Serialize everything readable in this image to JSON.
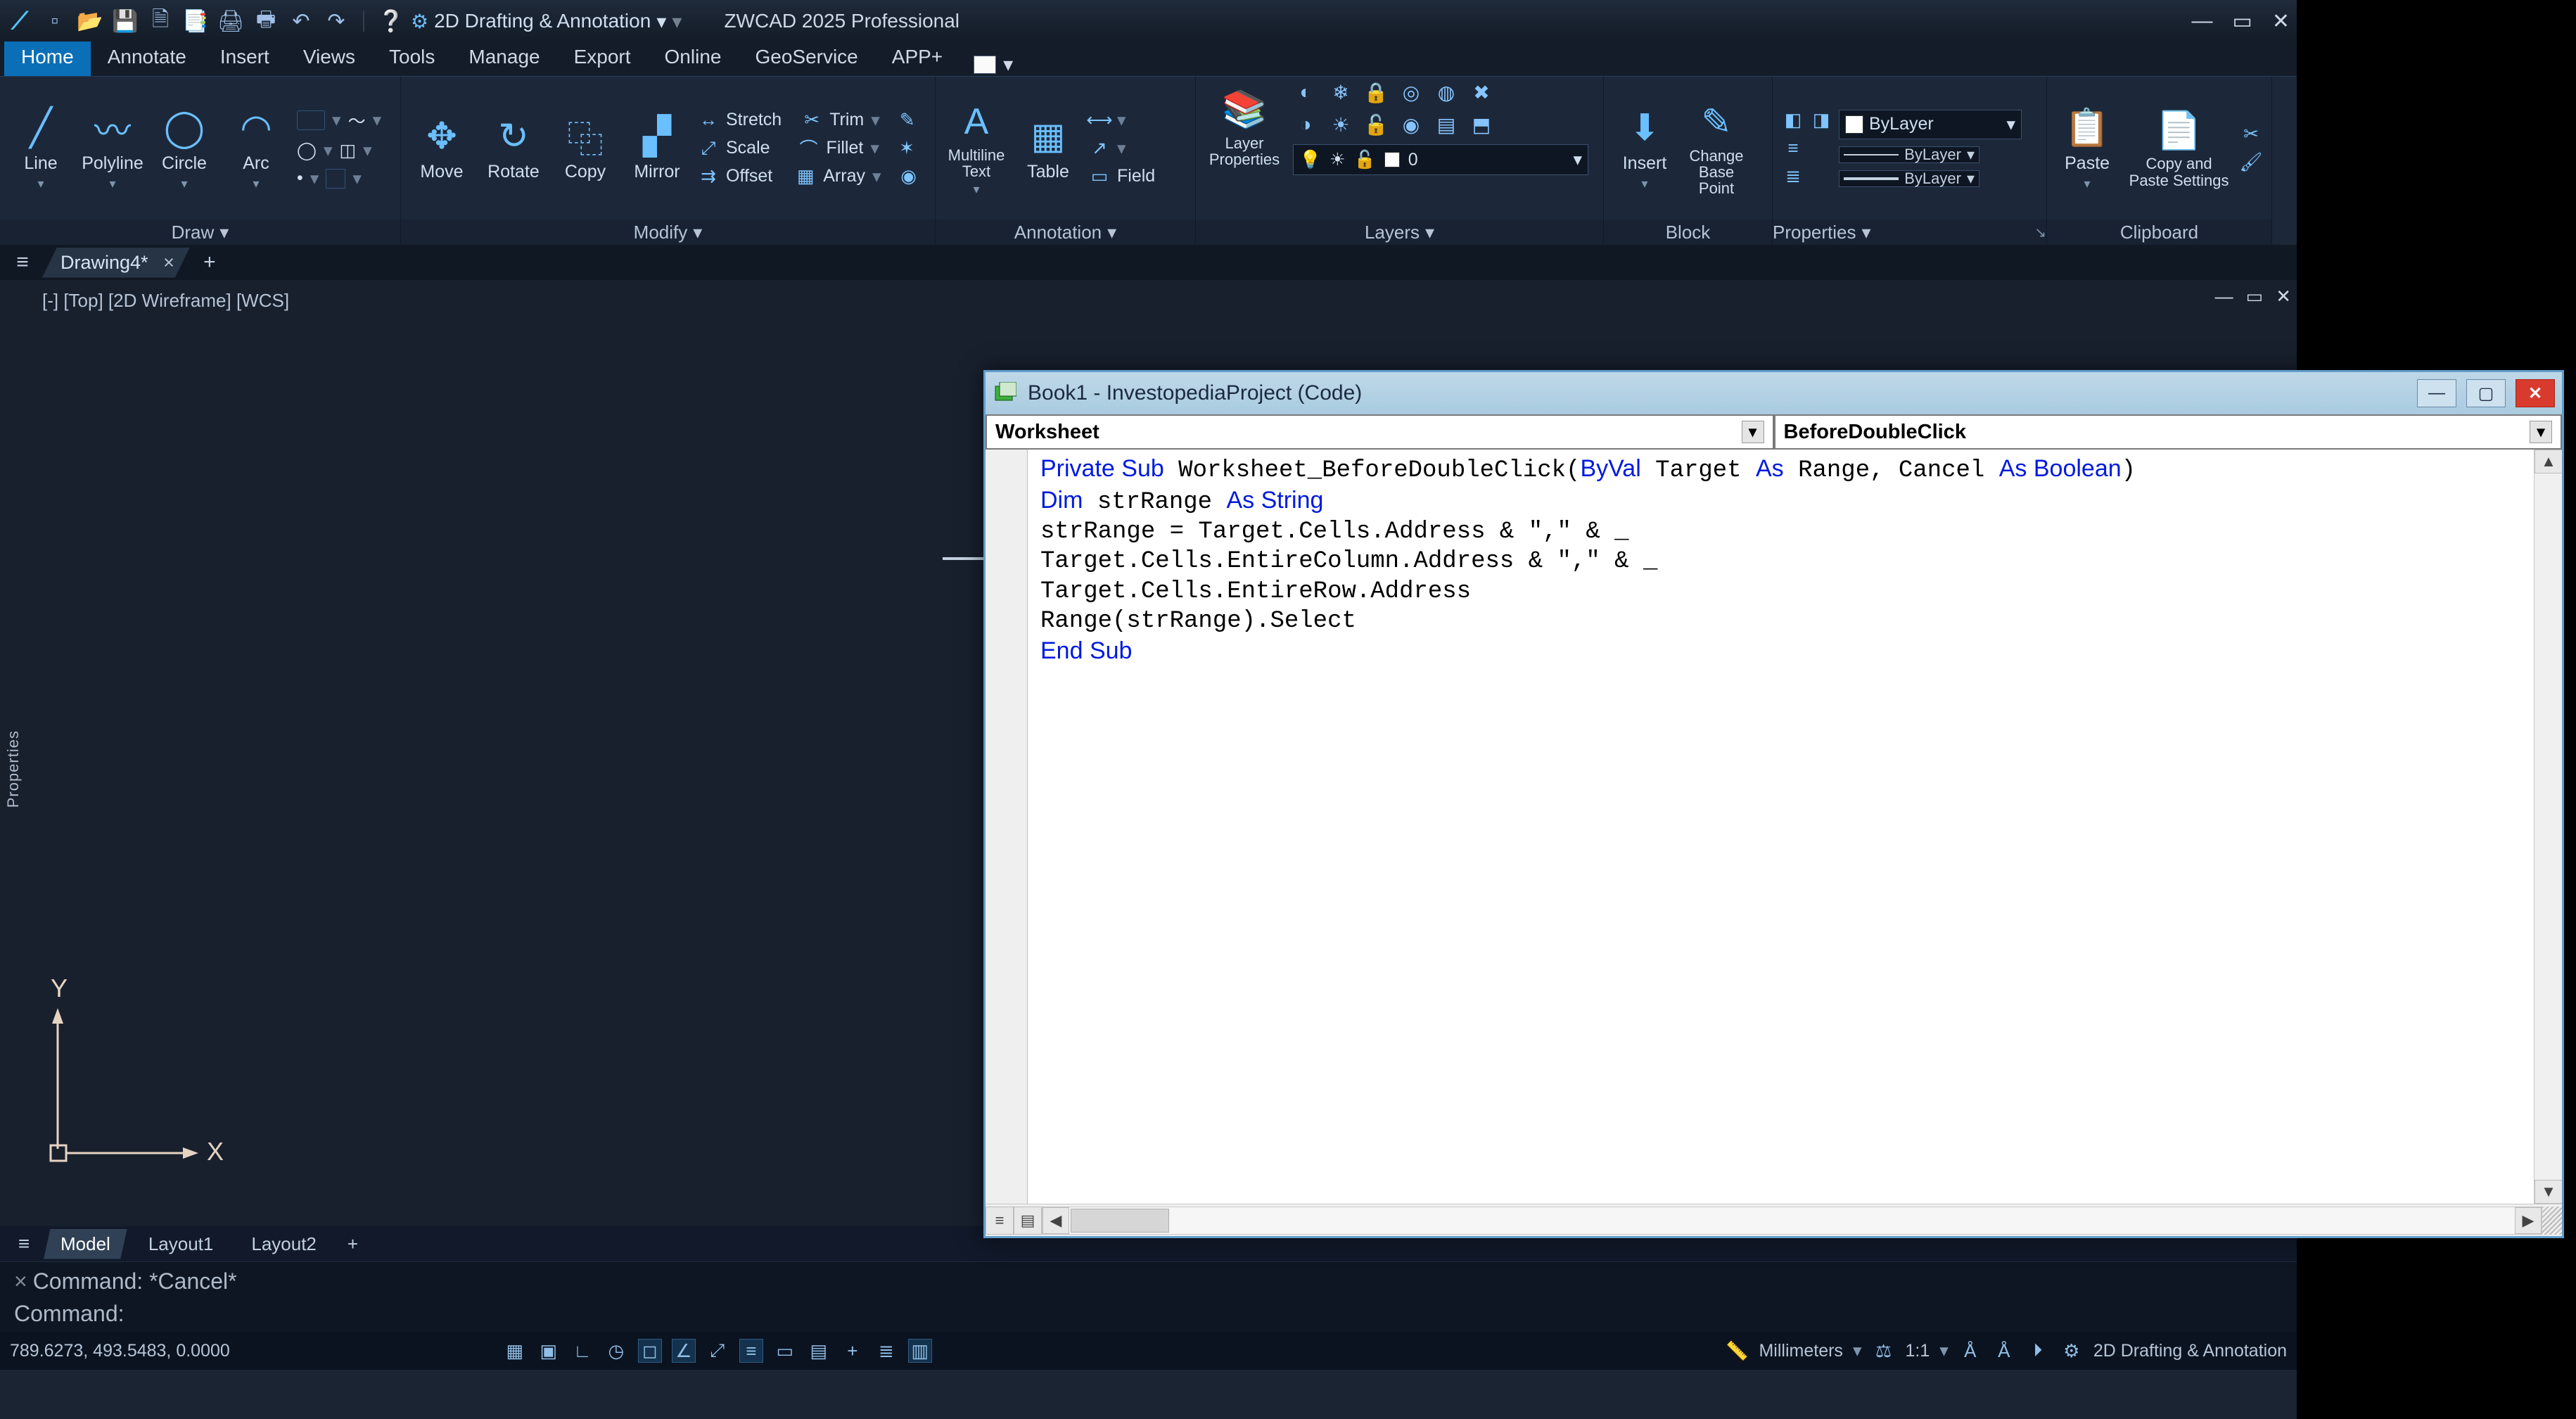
{
  "zwcad": {
    "workspace": "2D Drafting & Annotation",
    "app_title": "ZWCAD 2025 Professional",
    "tabs": [
      "Home",
      "Annotate",
      "Insert",
      "Views",
      "Tools",
      "Manage",
      "Export",
      "Online",
      "GeoService",
      "APP+"
    ],
    "active_tab": 0,
    "ribbon": {
      "draw": {
        "label": "Draw",
        "items": [
          "Line",
          "Polyline",
          "Circle",
          "Arc"
        ]
      },
      "modify": {
        "label": "Modify",
        "items": [
          "Move",
          "Rotate",
          "Copy",
          "Mirror"
        ],
        "rows": [
          "Stretch",
          "Scale",
          "Offset",
          "Trim",
          "Fillet",
          "Array"
        ]
      },
      "annotation": {
        "label": "Annotation",
        "items": [
          "Multiline Text",
          "Table"
        ],
        "field": "Field"
      },
      "layer": {
        "label": "Layers",
        "item": "Layer Properties",
        "current": "0"
      },
      "block": {
        "label": "Block",
        "items": [
          "Insert",
          "Change Base Point"
        ]
      },
      "properties": {
        "label": "Properties",
        "color": "ByLayer",
        "linetype": "ByLayer",
        "lineweight": "ByLayer"
      },
      "clipboard": {
        "label": "Clipboard",
        "items": [
          "Paste",
          "Copy and Paste Settings"
        ]
      }
    },
    "document_tab": "Drawing4*",
    "view_title": "[-] [Top] [2D Wireframe] [WCS]",
    "props_panel": "Properties",
    "axes": {
      "x": "X",
      "y": "Y"
    },
    "layout_tabs": [
      "Model",
      "Layout1",
      "Layout2"
    ],
    "active_layout": 0,
    "command_history": "Command: *Cancel*",
    "command_prompt": "Command:",
    "command_value": "",
    "status": {
      "coords": "789.6273, 493.5483, 0.0000",
      "units": "Millimeters",
      "scale": "1:1",
      "workspace": "2D Drafting & Annotation"
    }
  },
  "vba": {
    "title": "Book1 - InvestopediaProject (Code)",
    "left_sel": "Worksheet",
    "right_sel": "BeforeDoubleClick",
    "code_tokens": [
      {
        "t": "kw",
        "v": "Private Sub"
      },
      {
        "t": "",
        "v": " Worksheet_BeforeDoubleClick("
      },
      {
        "t": "kw",
        "v": "ByVal"
      },
      {
        "t": "",
        "v": " Target "
      },
      {
        "t": "kw",
        "v": "As"
      },
      {
        "t": "",
        "v": " Range, Cancel "
      },
      {
        "t": "kw",
        "v": "As Boolean"
      },
      {
        "t": "",
        "v": ")\n"
      },
      {
        "t": "kw",
        "v": "Dim"
      },
      {
        "t": "",
        "v": " strRange "
      },
      {
        "t": "kw",
        "v": "As String"
      },
      {
        "t": "",
        "v": "\n"
      },
      {
        "t": "",
        "v": "strRange = Target.Cells.Address & \",\" & _\n"
      },
      {
        "t": "",
        "v": "Target.Cells.EntireColumn.Address & \",\" & _\n"
      },
      {
        "t": "",
        "v": "Target.Cells.EntireRow.Address\n"
      },
      {
        "t": "",
        "v": "Range(strRange).Select\n"
      },
      {
        "t": "kw",
        "v": "End Sub"
      },
      {
        "t": "",
        "v": "\n"
      }
    ]
  }
}
